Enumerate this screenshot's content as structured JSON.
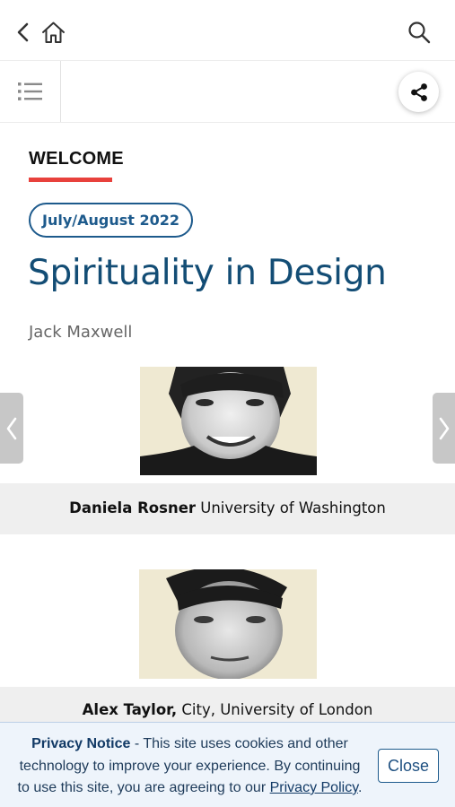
{
  "header": {
    "back_icon": "chevron-left-icon",
    "home_icon": "home-icon",
    "search_icon": "search-icon"
  },
  "toolbar": {
    "toc_icon": "list-icon",
    "share_icon": "share-icon"
  },
  "article": {
    "section": "WELCOME",
    "issue": "July/August 2022",
    "title": "Spirituality in Design",
    "author": "Jack Maxwell",
    "accent_color": "#e8413c",
    "title_color": "#134d75"
  },
  "people": [
    {
      "name": "Daniela Rosner",
      "affiliation": " University of Washington"
    },
    {
      "name": "Alex Taylor,",
      "affiliation": " City, University of London"
    }
  ],
  "privacy": {
    "heading": "Privacy Notice",
    "text": " - This site uses cookies and other technology to improve your experience. By continuing to use this site, you are agreeing to our ",
    "link": "Privacy Policy",
    "end": ".",
    "close_label": "Close"
  }
}
